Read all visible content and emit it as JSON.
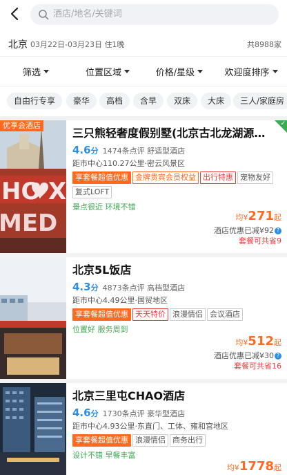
{
  "search": {
    "placeholder": "酒店/地名/关键词"
  },
  "city_row": {
    "city": "北京",
    "dates": "03月22日-03月23日 住1晚",
    "total": "共8988家"
  },
  "filters": [
    "筛选",
    "位置区域",
    "价格/星级",
    "欢迎度排序"
  ],
  "chips": [
    "自由行专享",
    "豪华",
    "高档",
    "含早",
    "双床",
    "大床",
    "三人/家庭房"
  ],
  "hotels": [
    {
      "badge": "优享会酒店",
      "name": "三只熊轻奢度假别墅(北京古北龙湖源…",
      "score": "4.6",
      "score_unit": "分",
      "reviews": "1474条点评",
      "type": "舒适型酒店",
      "distance": "距市中心110.27公里·密云风景区",
      "tags": [
        {
          "text": "享套餐超值优惠",
          "style": "solid"
        },
        {
          "text": "金牌贵宾会员权益",
          "style": "orange"
        },
        {
          "text": "出行特惠",
          "style": "red"
        },
        {
          "text": "宠物友好",
          "style": "plain"
        },
        {
          "text": "复式LOFT",
          "style": "plain"
        }
      ],
      "desc": "景点很近 环境不错",
      "price_prefix": "均¥",
      "price": "271",
      "price_suffix": "起",
      "discount": "酒店优惠已减¥92",
      "package": "套餐可共省9"
    },
    {
      "name": "北京5L饭店",
      "score": "4.3",
      "score_unit": "分",
      "reviews": "4873条点评",
      "type": "高档型酒店",
      "distance": "距市中心4.49公里·国贸地区",
      "tags": [
        {
          "text": "享套餐超值优惠",
          "style": "solid"
        },
        {
          "text": "天天特价",
          "style": "red"
        },
        {
          "text": "浪漫情侣",
          "style": "plain"
        },
        {
          "text": "会议酒店",
          "style": "plain"
        }
      ],
      "desc": "位置好 服务周到",
      "price_prefix": "均¥",
      "price": "512",
      "price_suffix": "起",
      "discount": "酒店优惠已减¥30",
      "package": "套餐可共省16"
    },
    {
      "name": "北京三里屯CHAO酒店",
      "score": "4.6",
      "score_unit": "分",
      "reviews": "1730条点评",
      "type": "豪华型酒店",
      "distance": "距市中心4.93公里·东直门、工体、雍和宫地区",
      "tags": [
        {
          "text": "享套餐超值优惠",
          "style": "solid"
        },
        {
          "text": "浪漫情侣",
          "style": "plain"
        },
        {
          "text": "商务出行",
          "style": "plain"
        }
      ],
      "desc": "设计不错 早餐丰富",
      "price_prefix": "均¥",
      "price": "1778",
      "price_suffix": "起"
    }
  ],
  "colors": {
    "accent": "#ff6a1f",
    "score": "#2b8ee8",
    "green": "#3dab52",
    "red": "#f03c3c"
  },
  "icons": [
    "back-arrow-icon",
    "search-icon",
    "help-icon",
    "check-icon"
  ]
}
